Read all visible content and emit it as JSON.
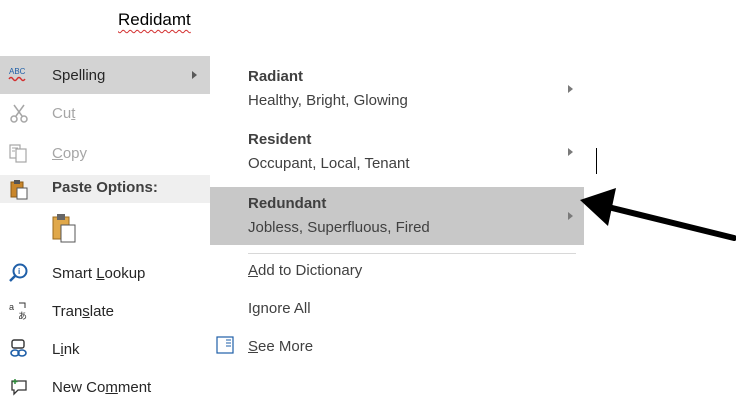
{
  "document": {
    "misspelled_word": "Redidamt"
  },
  "context_menu": {
    "spelling": {
      "label": "Spelling"
    },
    "cut": {
      "pre": "Cu",
      "key": "t",
      "post": ""
    },
    "copy": {
      "pre": "",
      "key": "C",
      "post": "opy"
    },
    "paste_options": {
      "label": "Paste Options:"
    },
    "smart_lookup": {
      "pre": "Smart ",
      "key": "L",
      "post": "ookup"
    },
    "translate": {
      "pre": "Tran",
      "key": "s",
      "post": "late"
    },
    "link": {
      "pre": "L",
      "key": "i",
      "post": "nk"
    },
    "new_comment": {
      "pre": "New Co",
      "key": "m",
      "post": "ment"
    },
    "spelling_icon_text": "ABC"
  },
  "spelling_submenu": {
    "suggestions": [
      {
        "word": "Radiant",
        "synonyms": "Healthy, Bright, Glowing"
      },
      {
        "word": "Resident",
        "synonyms": "Occupant, Local, Tenant"
      },
      {
        "word": "Redundant",
        "synonyms": "Jobless, Superfluous, Fired"
      }
    ],
    "add_to_dictionary": {
      "pre": "",
      "key": "A",
      "post": "dd to Dictionary"
    },
    "ignore_all": {
      "pre": "I",
      "key": "g",
      "post": "nore All"
    },
    "see_more": {
      "pre": "",
      "key": "S",
      "post": "ee More"
    }
  },
  "colors": {
    "highlight": "#c8c8c8",
    "spellcheck_underline": "#d32f2f",
    "icon_blue": "#1f5fa8",
    "arrow": "#000000"
  },
  "icons": [
    "spelling-abc-icon",
    "scissors-icon",
    "copy-icon",
    "clipboard-icon",
    "paste-keep-formatting-icon",
    "lightbulb-search-icon",
    "translate-icon",
    "link-chain-icon",
    "comment-icon",
    "see-more-icon",
    "pointer-arrow"
  ]
}
